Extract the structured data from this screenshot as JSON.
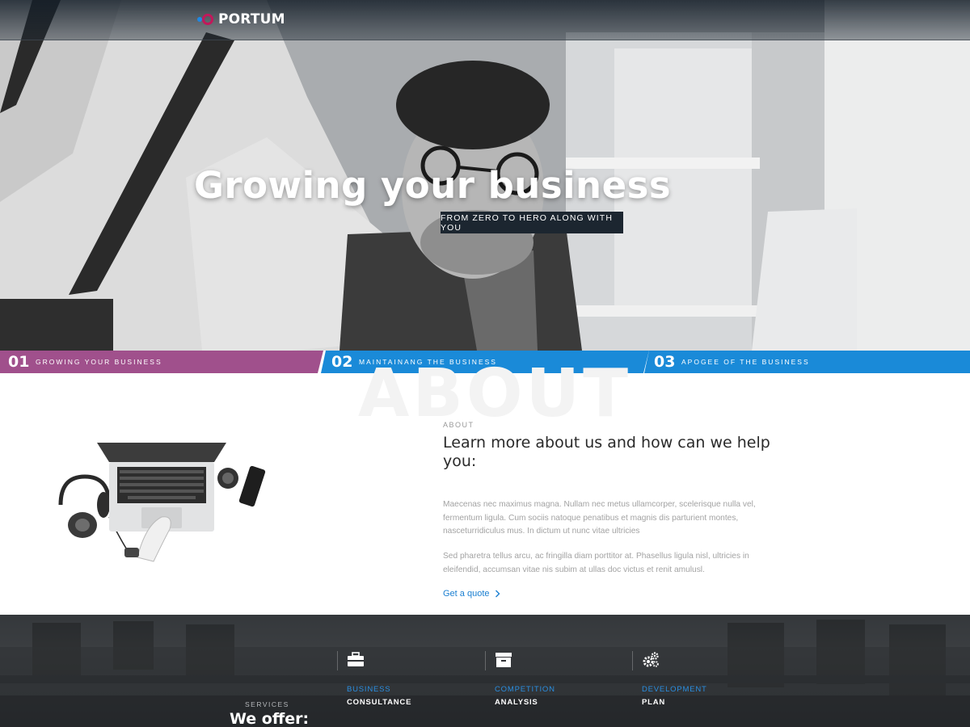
{
  "brand": {
    "name": "PORTUM"
  },
  "hero": {
    "title": "Growing your business",
    "tagline": "FROM ZERO TO HERO ALONG WITH YOU"
  },
  "steps": [
    {
      "number": "01",
      "label": "GROWING YOUR BUSINESS",
      "color": "#a0508c"
    },
    {
      "number": "02",
      "label": "MAINTAINANG THE BUSINESS",
      "color": "#1a8ad8"
    },
    {
      "number": "03",
      "label": "APOGEE OF THE BUSINESS",
      "color": "#1a8ad8"
    }
  ],
  "about": {
    "watermark": "ABOUT",
    "eyebrow": "ABOUT",
    "heading": "Learn more about us and how can we help you:",
    "paragraph1": "Maecenas nec maximus magna. Nullam nec metus ullamcorper, scelerisque nulla vel, fermentum ligula. Cum sociis natoque penatibus et magnis dis parturient montes, nasceturridiculus mus. In dictum ut nunc vitae ultricies",
    "paragraph2": "Sed pharetra tellus arcu, ac fringilla diam porttitor at. Phasellus ligula nisl, ultricies in eleifendid, accumsan vitae nis subim at ullas doc victus et renit amulusl.",
    "cta": "Get a quote",
    "cta_icon": "chevron-right-icon"
  },
  "services": {
    "eyebrow": "SERVICES",
    "title": "We offer:",
    "items": [
      {
        "icon": "briefcase-icon",
        "label": "BUSINESS",
        "sub": "CONSULTANCE"
      },
      {
        "icon": "archive-box-icon",
        "label": "COMPETITION",
        "sub": "ANALYSIS"
      },
      {
        "icon": "gears-icon",
        "label": "DEVELOPMENT",
        "sub": "PLAN"
      }
    ]
  },
  "colors": {
    "accent_blue": "#1a8ad8",
    "accent_purple": "#a0508c",
    "logo_red": "#c2185b",
    "link_blue": "#1a7fd1"
  }
}
